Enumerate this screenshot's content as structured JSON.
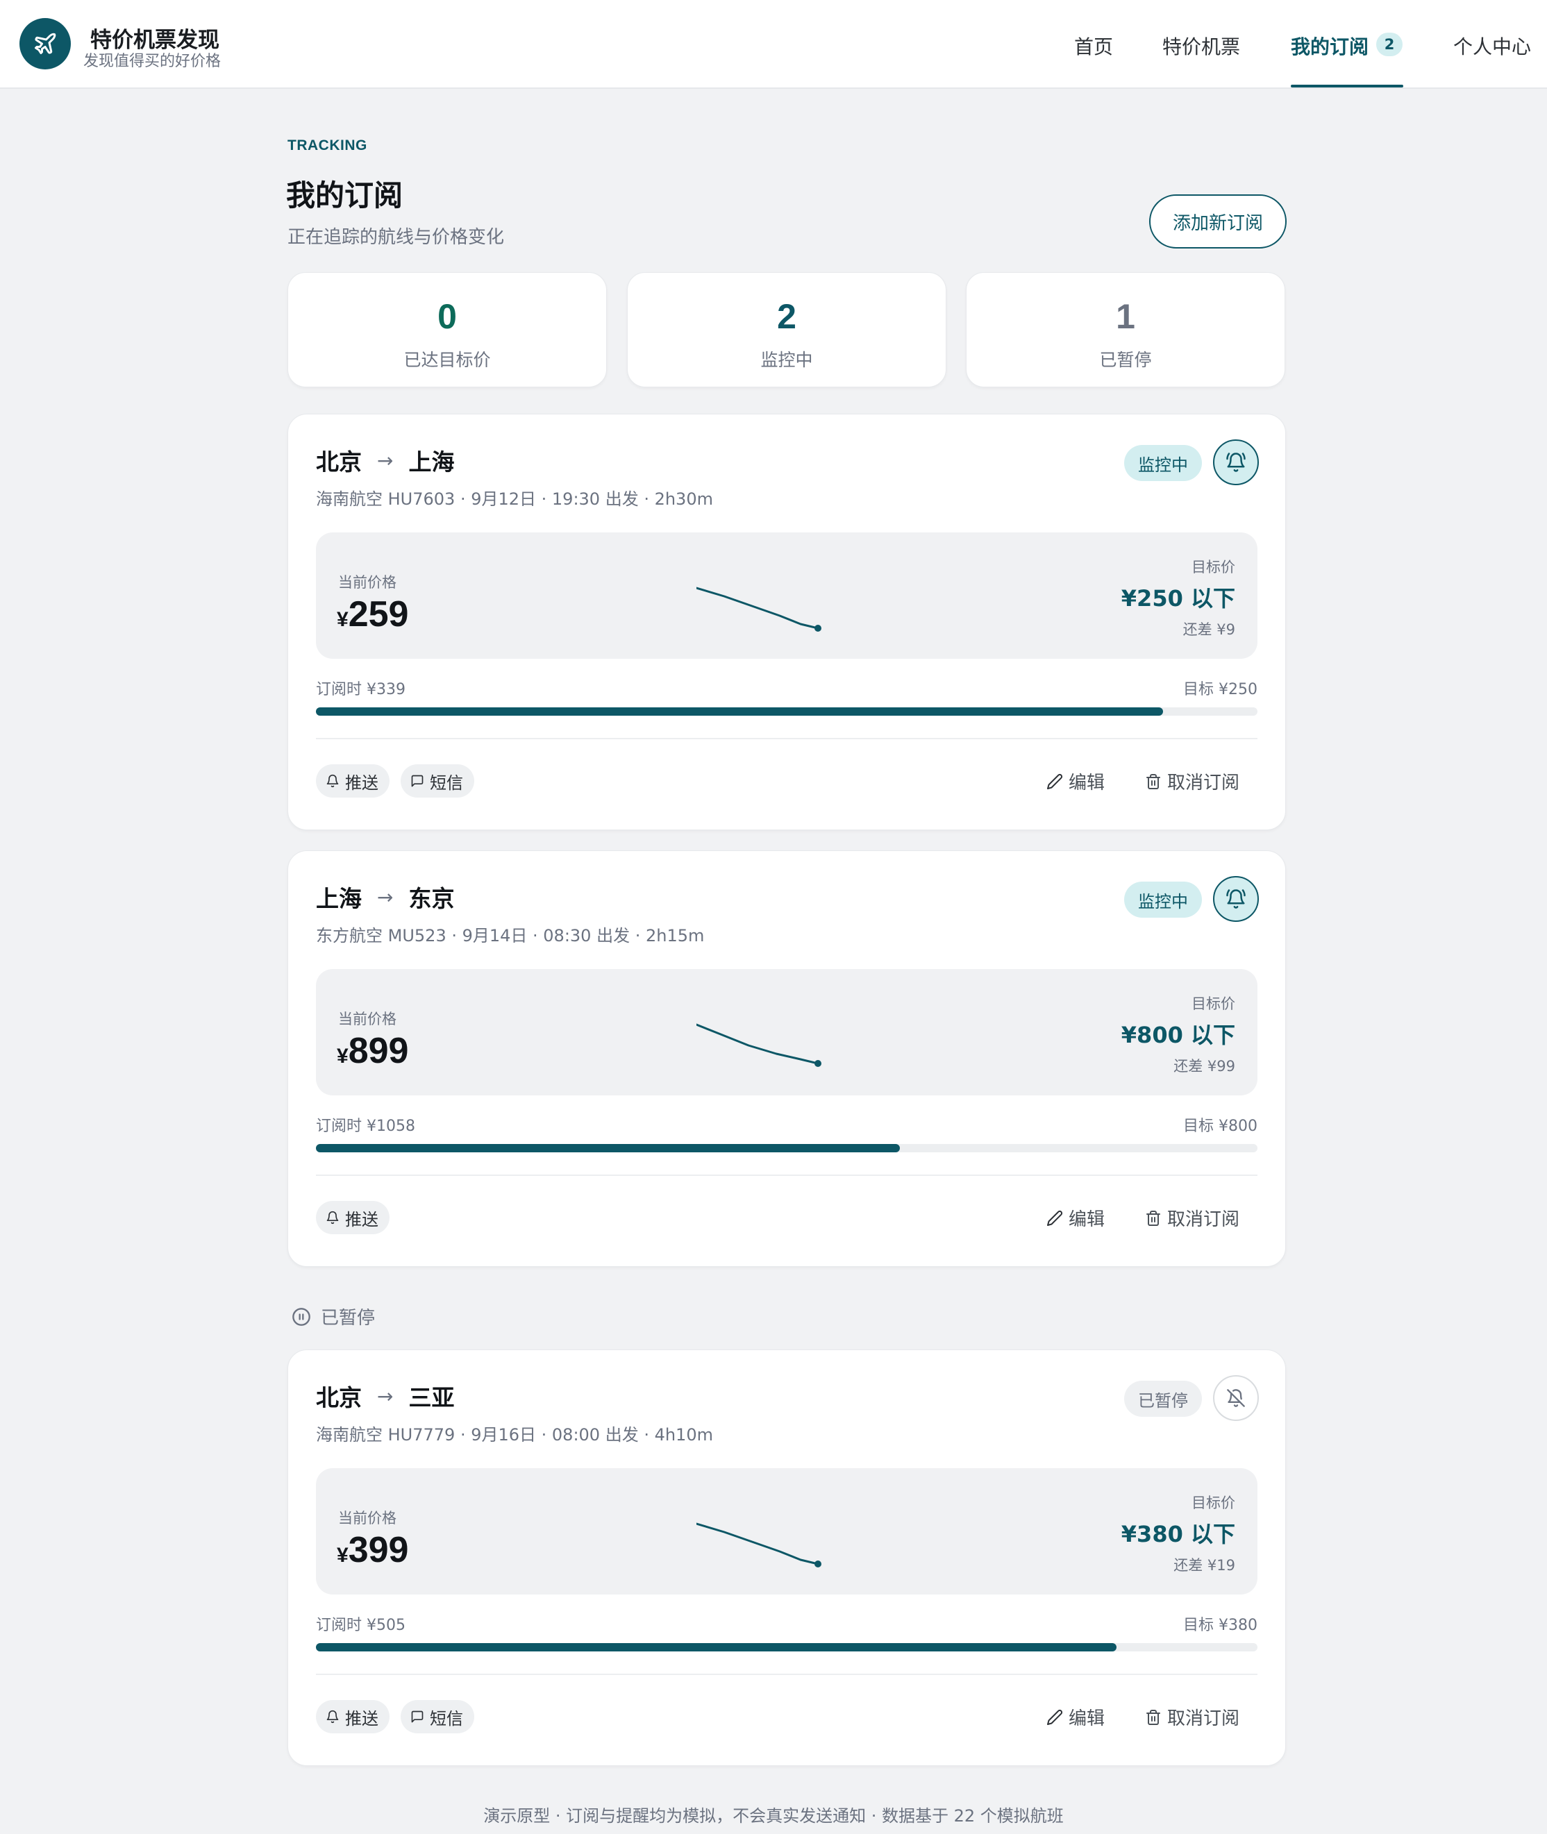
{
  "brand": {
    "title": "特价机票发现",
    "subtitle": "发现值得买的好价格"
  },
  "nav": {
    "items": [
      "首页",
      "特价机票",
      "我的订阅",
      "个人中心"
    ],
    "active": "我的订阅",
    "badge": "2"
  },
  "page": {
    "eyebrow": "TRACKING",
    "title": "我的订阅",
    "subtitle": "正在追踪的航线与价格变化",
    "add_button": "添加新订阅"
  },
  "stats": [
    {
      "value": "0",
      "label": "已达目标价",
      "color": "#0d6b5a"
    },
    {
      "value": "2",
      "label": "监控中",
      "color": "#0d5766"
    },
    {
      "value": "1",
      "label": "已暂停",
      "color": "#6b7280"
    }
  ],
  "paused_section_label": "已暂停",
  "labels": {
    "current_price": "当前价格",
    "target_price": "目标价",
    "edit": "编辑",
    "unsubscribe": "取消订阅",
    "currency": "¥"
  },
  "subscriptions": [
    {
      "from": "北京",
      "to": "上海",
      "meta": "海南航空 HU7603 · 9月12日 · 19:30 出发 · 2h30m",
      "status": "监控中",
      "active": true,
      "current_price": "259",
      "target": "¥250 以下",
      "gap": "还差 ¥9",
      "range_start": "订阅时 ¥339",
      "range_end": "目标 ¥250",
      "progress": 0.9,
      "channels": [
        "推送",
        "短信"
      ]
    },
    {
      "from": "上海",
      "to": "东京",
      "meta": "东方航空 MU523 · 9月14日 · 08:30 出发 · 2h15m",
      "status": "监控中",
      "active": true,
      "current_price": "899",
      "target": "¥800 以下",
      "gap": "还差 ¥99",
      "range_start": "订阅时 ¥1058",
      "range_end": "目标 ¥800",
      "progress": 0.62,
      "channels": [
        "推送"
      ]
    },
    {
      "from": "北京",
      "to": "三亚",
      "meta": "海南航空 HU7779 · 9月16日 · 08:00 出发 · 4h10m",
      "status": "已暂停",
      "active": false,
      "current_price": "399",
      "target": "¥380 以下",
      "gap": "还差 ¥19",
      "range_start": "订阅时 ¥505",
      "range_end": "目标 ¥380",
      "progress": 0.85,
      "channels": [
        "推送",
        "短信"
      ]
    }
  ],
  "footer": "演示原型 · 订阅与提醒均为模拟，不会真实发送通知 · 数据基于 22 个模拟航班",
  "colors": {
    "accent": "#0d5766",
    "accent_soft": "#d3eef0",
    "background": "#f1f2f4"
  }
}
